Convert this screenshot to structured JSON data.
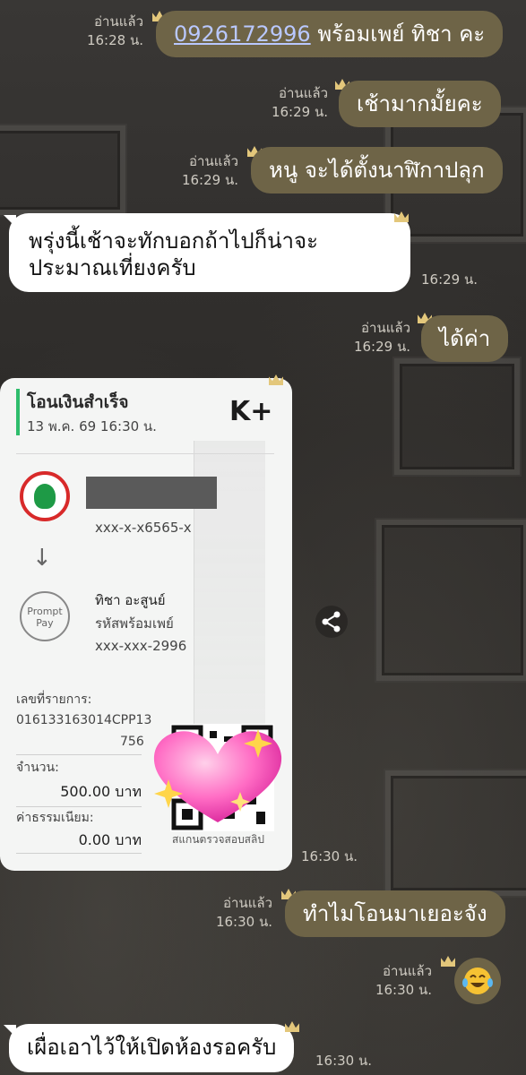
{
  "messages": [
    {
      "id": "m1",
      "side": "out",
      "read": "อ่านแล้ว",
      "time": "16:28 น.",
      "phone": "0926172996",
      "text": " พร้อมเพย์ ทิชา คะ"
    },
    {
      "id": "m2",
      "side": "out",
      "read": "อ่านแล้ว",
      "time": "16:29 น.",
      "text": "เช้ามากมั้ยคะ"
    },
    {
      "id": "m3",
      "side": "out",
      "read": "อ่านแล้ว",
      "time": "16:29 น.",
      "text": "หนู จะได้ตั้งนาฬิกาปลุก"
    },
    {
      "id": "m4",
      "side": "in",
      "time": "16:29 น.",
      "line1": "พรุ่งนี้เช้าจะทักบอกถ้าไปก็น่าจะ",
      "line2": "ประมาณเที่ยงครับ"
    },
    {
      "id": "m5",
      "side": "out",
      "read": "อ่านแล้ว",
      "time": "16:29 น.",
      "text": "ได้ค่า"
    },
    {
      "id": "m6",
      "side": "in",
      "time": "16:30 น.",
      "type": "slip"
    },
    {
      "id": "m7",
      "side": "out",
      "read": "อ่านแล้ว",
      "time": "16:30 น.",
      "text": "ทำไมโอนมาเยอะจัง"
    },
    {
      "id": "m8",
      "side": "out",
      "read": "อ่านแล้ว",
      "time": "16:30 น.",
      "type": "emoji",
      "emoji": "laughing-crying"
    },
    {
      "id": "m9",
      "side": "in",
      "time": "16:30 น.",
      "text": "เผื่อเอาไว้ให้เปิดห้องรอครับ"
    }
  ],
  "slip": {
    "title": "โอนเงินสำเร็จ",
    "date": "13 พ.ค. 69  16:30 น.",
    "brand": "K+",
    "from_account": "xxx-x-x6565-x",
    "to_name": "ทิชา อะสูนย์",
    "to_label": "รหัสพร้อมเพย์",
    "to_account": "xxx-xxx-2996",
    "promptpay_logo": "Prompt Pay",
    "ref_label": "เลขที่รายการ:",
    "ref_line1": "016133163014CPP13",
    "ref_line2": "756",
    "amount_label": "จำนวน:",
    "amount_value": "500.00 บาท",
    "fee_label": "ค่าธรรมเนียม:",
    "fee_value": "0.00 บาท",
    "qr_caption": "สแกนตรวจสอบสลิป"
  },
  "icons": {
    "share": "share-icon",
    "crown": "crown-icon",
    "heart": "sparkling-heart-icon"
  },
  "colors": {
    "outgoing_bubble": "#6e6447",
    "incoming_bubble": "#ffffff",
    "slip_accent": "#2ebd6c"
  }
}
